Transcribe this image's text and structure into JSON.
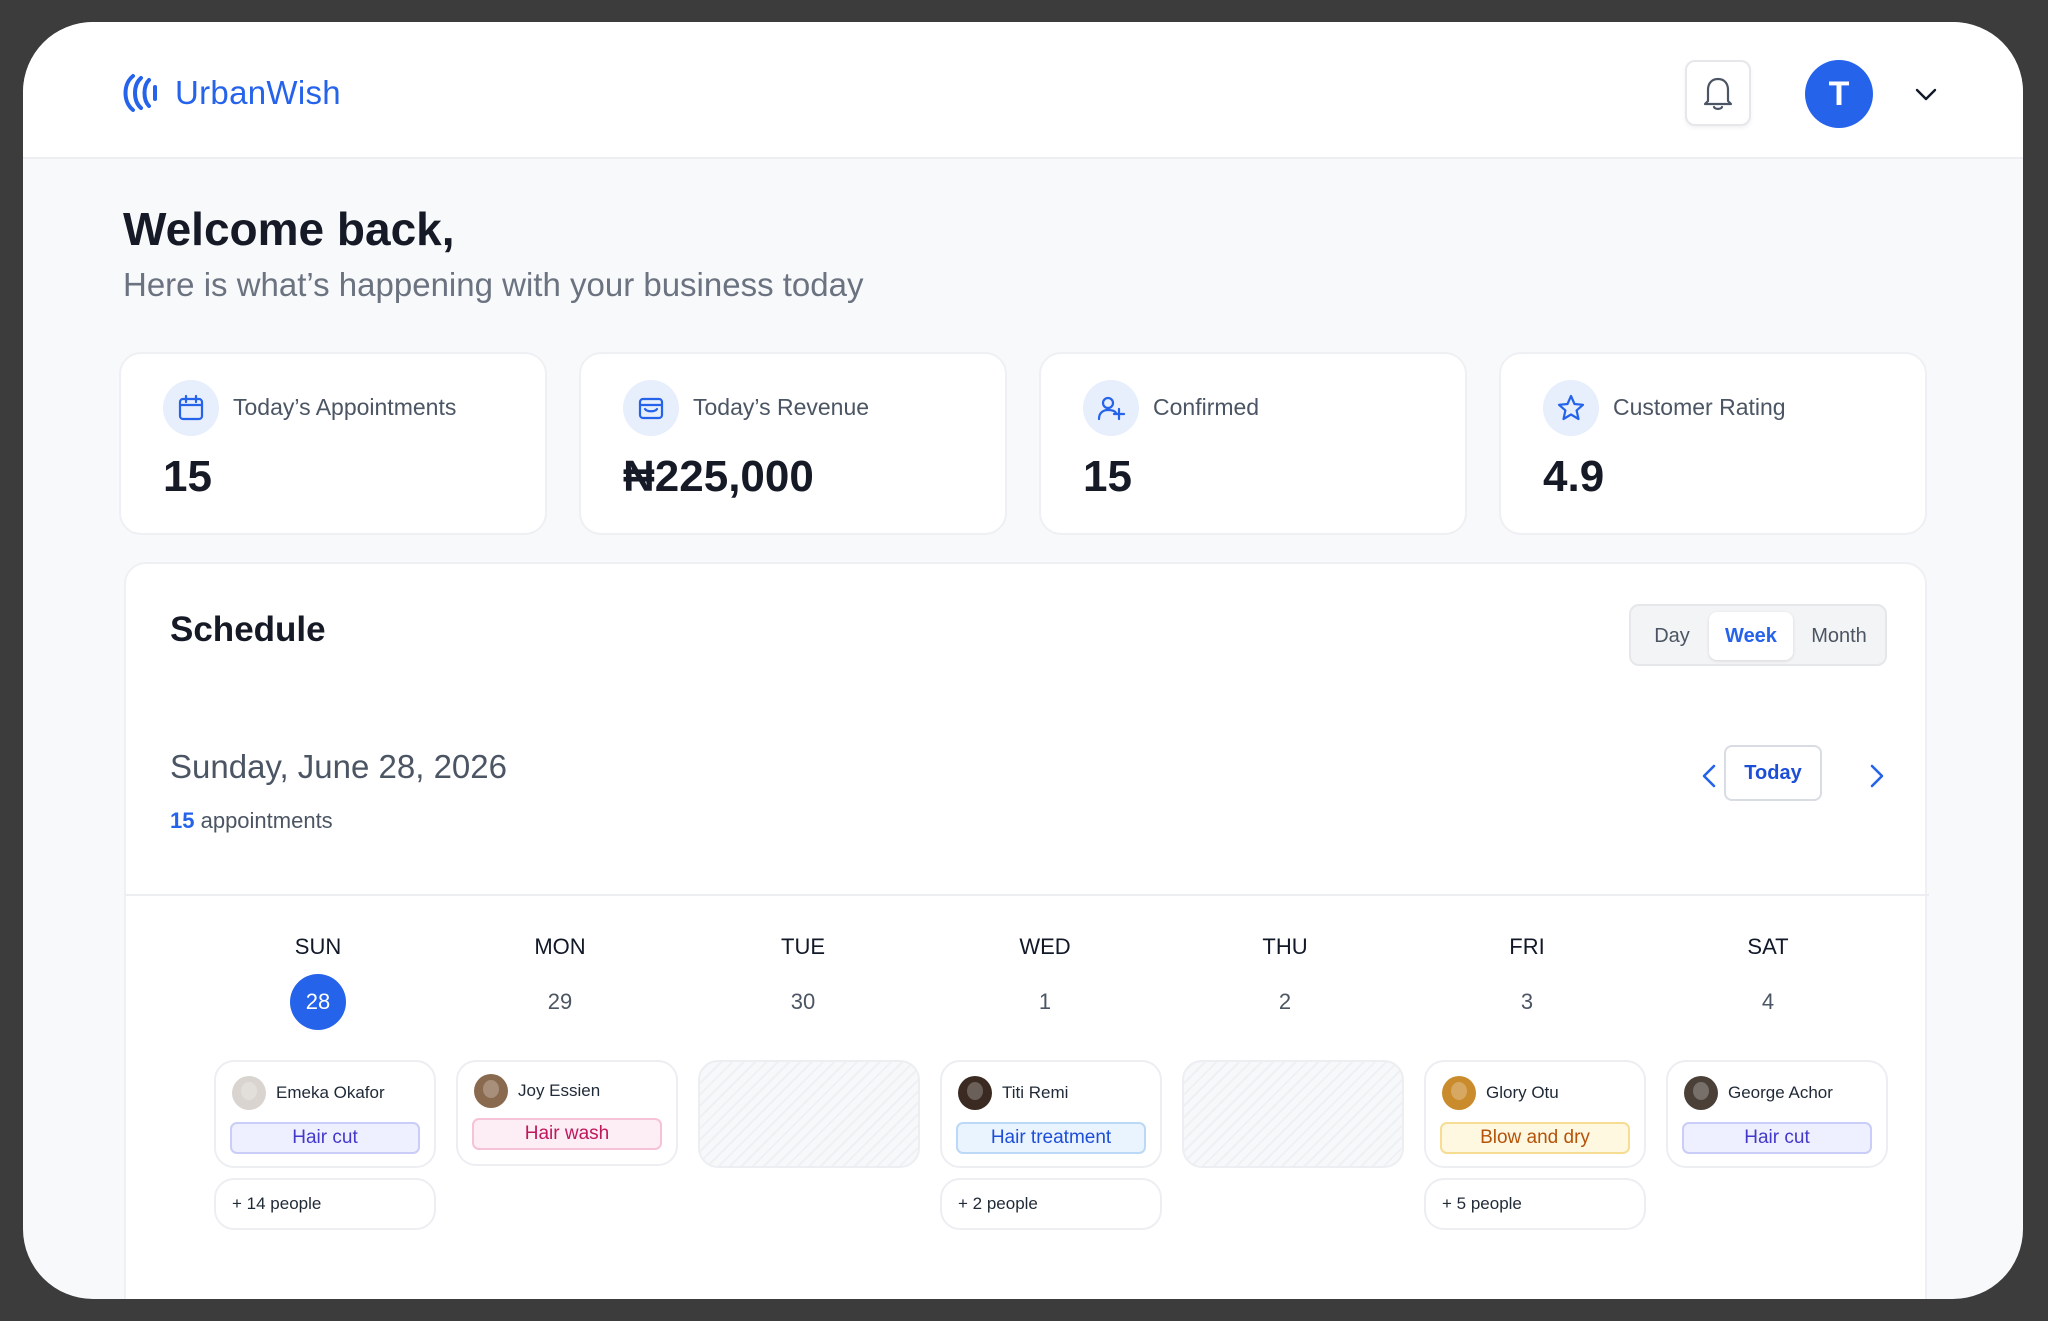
{
  "brand": {
    "name": "UrbanWish",
    "color": "#2563eb"
  },
  "header": {
    "avatar_initial": "T",
    "notification_icon": "bell-icon",
    "menu_icon": "chevron-down-icon"
  },
  "welcome": {
    "title": "Welcome back,",
    "subtitle": "Here is what’s happening with your business today"
  },
  "stats": [
    {
      "label": "Today’s Appointments",
      "value": "15",
      "icon": "calendar-icon"
    },
    {
      "label": "Today’s Revenue",
      "value": "₦225,000",
      "icon": "wallet-icon"
    },
    {
      "label": "Confirmed",
      "value": "15",
      "icon": "user-plus-icon"
    },
    {
      "label": "Customer Rating",
      "value": "4.9",
      "icon": "star-icon"
    }
  ],
  "schedule": {
    "title": "Schedule",
    "views": [
      "Day",
      "Week",
      "Month"
    ],
    "active_view": "Week",
    "date_heading": "Sunday, June 28, 2026",
    "appointment_count": "15",
    "appointment_count_suffix": " appointments",
    "today_label": "Today",
    "days": [
      {
        "name": "SUN",
        "num": "28",
        "active": true
      },
      {
        "name": "MON",
        "num": "29"
      },
      {
        "name": "TUE",
        "num": "30"
      },
      {
        "name": "WED",
        "num": "1"
      },
      {
        "name": "THU",
        "num": "2"
      },
      {
        "name": "FRI",
        "num": "3"
      },
      {
        "name": "SAT",
        "num": "4"
      }
    ],
    "appointments": [
      {
        "person": "Emeka Okafor",
        "service": "Hair cut",
        "more": "+ 14 people"
      },
      {
        "person": "Joy Essien",
        "service": "Hair wash"
      },
      null,
      {
        "person": "Titi Remi",
        "service": "Hair treatment",
        "more": "+ 2 people"
      },
      null,
      {
        "person": "Glory Otu",
        "service": "Blow and dry",
        "more": "+ 5 people"
      },
      {
        "person": "George Achor",
        "service": "Hair cut"
      }
    ]
  }
}
